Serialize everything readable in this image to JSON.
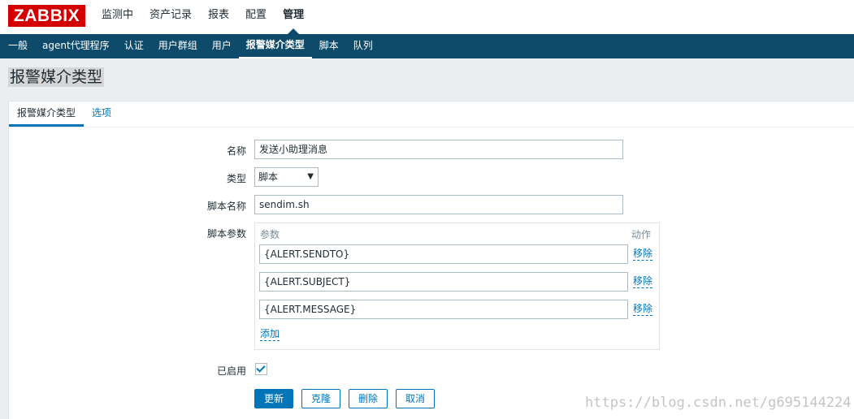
{
  "logo": "ZABBIX",
  "top_nav": [
    {
      "label": "监测中"
    },
    {
      "label": "资产记录"
    },
    {
      "label": "报表"
    },
    {
      "label": "配置"
    },
    {
      "label": "管理"
    }
  ],
  "sub_nav": [
    {
      "label": "一般"
    },
    {
      "label": "agent代理程序"
    },
    {
      "label": "认证"
    },
    {
      "label": "用户群组"
    },
    {
      "label": "用户"
    },
    {
      "label": "报警媒介类型"
    },
    {
      "label": "脚本"
    },
    {
      "label": "队列"
    }
  ],
  "page_title": "报警媒介类型",
  "tabs": [
    {
      "label": "报警媒介类型"
    },
    {
      "label": "选项"
    }
  ],
  "form": {
    "name_label": "名称",
    "name_value": "发送小助理消息",
    "type_label": "类型",
    "type_value": "脚本",
    "script_name_label": "脚本名称",
    "script_name_value": "sendim.sh",
    "script_params_label": "脚本参数",
    "params_header": "参数",
    "action_header": "动作",
    "params": [
      {
        "value": "{ALERT.SENDTO}",
        "remove": "移除"
      },
      {
        "value": "{ALERT.SUBJECT}",
        "remove": "移除"
      },
      {
        "value": "{ALERT.MESSAGE}",
        "remove": "移除"
      }
    ],
    "add_label": "添加",
    "enabled_label": "已启用",
    "enabled": true
  },
  "buttons": {
    "update": "更新",
    "clone": "克隆",
    "delete": "删除",
    "cancel": "取消"
  },
  "watermark": "https://blog.csdn.net/g695144224"
}
